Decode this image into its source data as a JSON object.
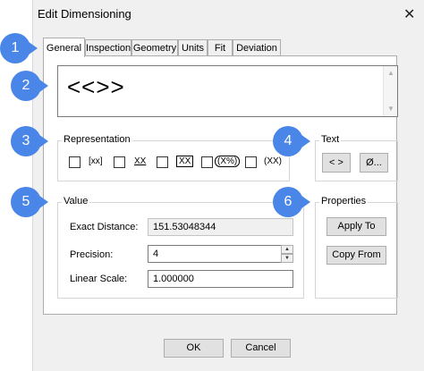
{
  "window": {
    "title": "Edit Dimensioning",
    "close_label": "✕"
  },
  "tabs": [
    {
      "label": "General",
      "active": true
    },
    {
      "label": "Inspection",
      "active": false
    },
    {
      "label": "Geometry",
      "active": false
    },
    {
      "label": "Units",
      "active": false
    },
    {
      "label": "Fit",
      "active": false
    },
    {
      "label": "Deviation",
      "active": false
    }
  ],
  "dimension_text": {
    "value": "<<>>"
  },
  "representation": {
    "label": "Representation",
    "options": [
      {
        "symbol": "[xx]",
        "checked": false
      },
      {
        "symbol": "XX",
        "checked": false
      },
      {
        "symbol": "XX",
        "checked": false
      },
      {
        "symbol": "(X%)",
        "checked": false
      },
      {
        "symbol": "(XX)",
        "checked": false
      }
    ]
  },
  "text_group": {
    "label": "Text",
    "insert_label": "< >",
    "diameter_label": "Ø..."
  },
  "value_group": {
    "label": "Value",
    "exact_distance_label": "Exact Distance:",
    "exact_distance_value": "151.53048344",
    "precision_label": "Precision:",
    "precision_value": "4",
    "linear_scale_label": "Linear Scale:",
    "linear_scale_value": "1.000000"
  },
  "properties_group": {
    "label": "Properties",
    "apply_to_label": "Apply To",
    "copy_from_label": "Copy From"
  },
  "footer": {
    "ok_label": "OK",
    "cancel_label": "Cancel"
  },
  "callouts": [
    "1",
    "2",
    "3",
    "4",
    "5",
    "6"
  ],
  "colors": {
    "callout": "#4a86e8",
    "dialog_bg": "#f0f0f0",
    "panel_bg": "#ffffff"
  }
}
